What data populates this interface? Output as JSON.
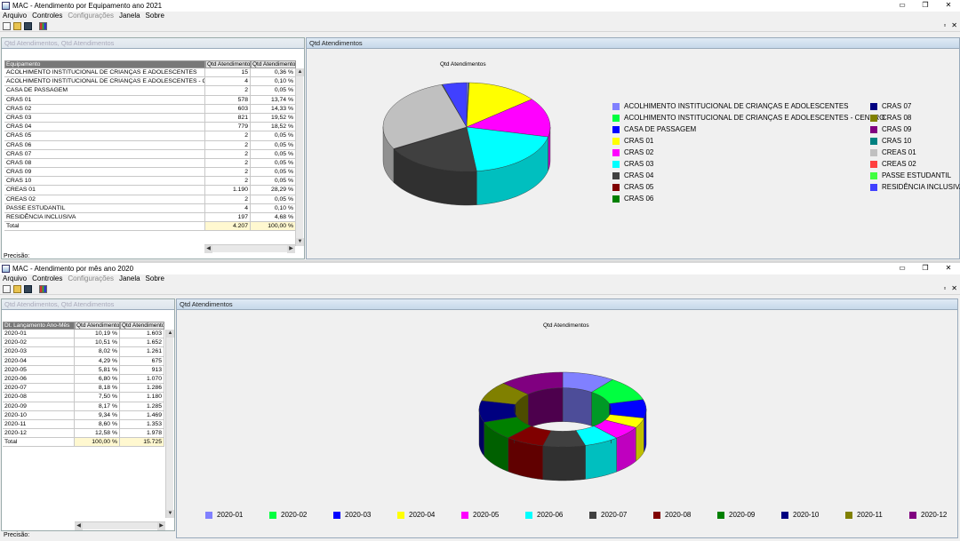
{
  "window1": {
    "title": "MAC - Atendimento por Equipamento ano 2021",
    "menu": [
      "Arquivo",
      "Controles",
      "Configurações",
      "Janela",
      "Sobre"
    ],
    "left_pane_title": "Qtd Atendimentos, Qtd Atendimentos",
    "chart_pane_title": "Qtd Atendimentos",
    "table": {
      "headers": [
        "Equipamento",
        "Qtd Atendimentos",
        "Qtd Atendimentos"
      ],
      "rows": [
        [
          "ACOLHIMENTO INSTITUCIONAL DE CRIANÇAS E ADOLESCENTES",
          "15",
          "0,36 %"
        ],
        [
          "ACOLHIMENTO INSTITUCIONAL DE CRIANÇAS E ADOLESCENTES - CENTRO",
          "4",
          "0,10 %"
        ],
        [
          "CASA DE PASSAGEM",
          "2",
          "0,05 %"
        ],
        [
          "CRAS 01",
          "578",
          "13,74 %"
        ],
        [
          "CRAS 02",
          "603",
          "14,33 %"
        ],
        [
          "CRAS 03",
          "821",
          "19,52 %"
        ],
        [
          "CRAS 04",
          "779",
          "18,52 %"
        ],
        [
          "CRAS 05",
          "2",
          "0,05 %"
        ],
        [
          "CRAS 06",
          "2",
          "0,05 %"
        ],
        [
          "CRAS 07",
          "2",
          "0,05 %"
        ],
        [
          "CRAS 08",
          "2",
          "0,05 %"
        ],
        [
          "CRAS 09",
          "2",
          "0,05 %"
        ],
        [
          "CRAS 10",
          "2",
          "0,05 %"
        ],
        [
          "CREAS 01",
          "1.190",
          "28,29 %"
        ],
        [
          "CREAS 02",
          "2",
          "0,05 %"
        ],
        [
          "PASSE ESTUDANTIL",
          "4",
          "0,10 %"
        ],
        [
          "RESIDÊNCIA INCLUSIVA",
          "197",
          "4,68 %"
        ]
      ],
      "total": [
        "Total",
        "4.207",
        "100,00 %"
      ]
    },
    "status": "Precisão:"
  },
  "window2": {
    "title": "MAC - Atendimento por mês ano 2020",
    "menu": [
      "Arquivo",
      "Controles",
      "Configurações",
      "Janela",
      "Sobre"
    ],
    "left_pane_title": "Qtd Atendimentos, Qtd Atendimentos",
    "chart_pane_title": "Qtd Atendimentos",
    "table": {
      "headers": [
        "Dt. Lançamento Ano-Mês",
        "Qtd Atendimentos",
        "Qtd Atendimentos"
      ],
      "rows": [
        [
          "2020-01",
          "10,19 %",
          "1.603"
        ],
        [
          "2020-02",
          "10,51 %",
          "1.652"
        ],
        [
          "2020-03",
          "8,02 %",
          "1.261"
        ],
        [
          "2020-04",
          "4,29 %",
          "675"
        ],
        [
          "2020-05",
          "5,81 %",
          "913"
        ],
        [
          "2020-06",
          "6,80 %",
          "1.070"
        ],
        [
          "2020-07",
          "8,18 %",
          "1.286"
        ],
        [
          "2020-08",
          "7,50 %",
          "1.180"
        ],
        [
          "2020-09",
          "8,17 %",
          "1.285"
        ],
        [
          "2020-10",
          "9,34 %",
          "1.469"
        ],
        [
          "2020-11",
          "8,60 %",
          "1.353"
        ],
        [
          "2020-12",
          "12,58 %",
          "1.978"
        ]
      ],
      "total": [
        "Total",
        "100,00 %",
        "15.725"
      ]
    },
    "status": "Precisão:"
  },
  "chart_data": [
    {
      "type": "pie",
      "title": "Qtd Atendimentos",
      "legend_position": "right",
      "categories": [
        "ACOLHIMENTO INSTITUCIONAL DE CRIANÇAS E ADOLESCENTES",
        "ACOLHIMENTO INSTITUCIONAL DE CRIANÇAS E ADOLESCENTES - CENTRO",
        "CASA DE PASSAGEM",
        "CRAS 01",
        "CRAS 02",
        "CRAS 03",
        "CRAS 04",
        "CRAS 05",
        "CRAS 06",
        "CRAS 07",
        "CRAS 08",
        "CRAS 09",
        "CRAS 10",
        "CREAS 01",
        "CREAS 02",
        "PASSE ESTUDANTIL",
        "RESIDÊNCIA INCLUSIVA"
      ],
      "values": [
        15,
        4,
        2,
        578,
        603,
        821,
        779,
        2,
        2,
        2,
        2,
        2,
        2,
        1190,
        2,
        4,
        197
      ],
      "colors": [
        "#8080ff",
        "#00ff40",
        "#0000ff",
        "#ffff00",
        "#ff00ff",
        "#00ffff",
        "#404040",
        "#800000",
        "#008000",
        "#000080",
        "#808000",
        "#800080",
        "#008080",
        "#c0c0c0",
        "#ff4040",
        "#40ff40",
        "#4040ff"
      ]
    },
    {
      "type": "pie",
      "title": "Qtd Atendimentos",
      "legend_position": "bottom",
      "categories": [
        "2020-01",
        "2020-02",
        "2020-03",
        "2020-04",
        "2020-05",
        "2020-06",
        "2020-07",
        "2020-08",
        "2020-09",
        "2020-10",
        "2020-11",
        "2020-12"
      ],
      "values": [
        1603,
        1652,
        1261,
        675,
        913,
        1070,
        1286,
        1180,
        1285,
        1469,
        1353,
        1978
      ],
      "colors": [
        "#8080ff",
        "#00ff40",
        "#0000ff",
        "#ffff00",
        "#ff00ff",
        "#00ffff",
        "#404040",
        "#800000",
        "#008000",
        "#000080",
        "#808000",
        "#800080"
      ]
    }
  ]
}
